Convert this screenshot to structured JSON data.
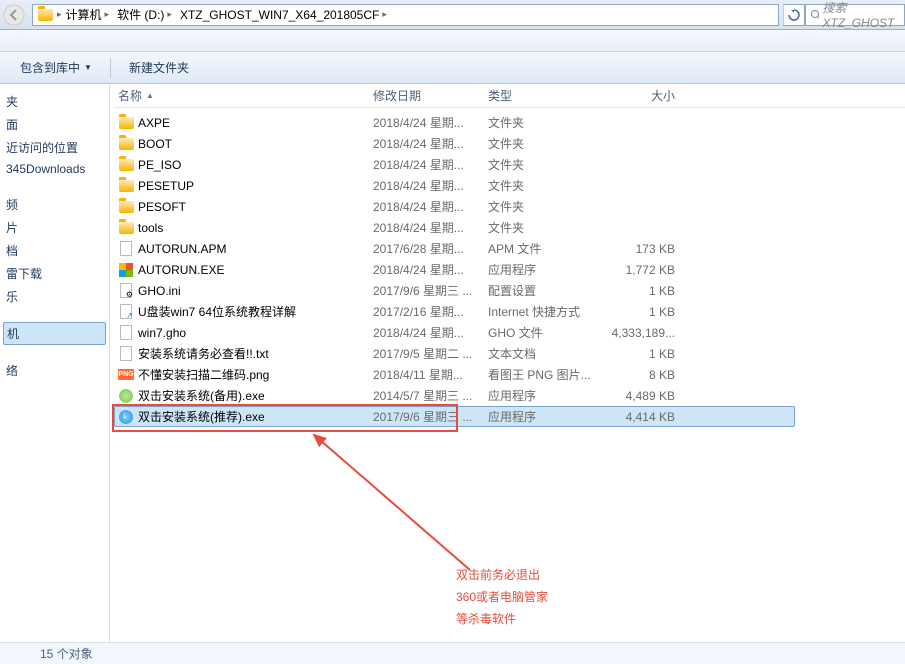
{
  "breadcrumb": {
    "root": "计算机",
    "drive": "软件 (D:)",
    "folder": "XTZ_GHOST_WIN7_X64_201805CF"
  },
  "search": {
    "placeholder": "搜索 XTZ_GHOST"
  },
  "toolbar": {
    "include": "包含到库中",
    "newfolder": "新建文件夹"
  },
  "sidebar": {
    "items": [
      "夹",
      "面",
      "近访问的位置",
      "345Downloads",
      "",
      "频",
      "片",
      "档",
      "雷下载",
      "乐",
      "",
      "机",
      "",
      "络"
    ]
  },
  "columns": {
    "name": "名称",
    "date": "修改日期",
    "type": "类型",
    "size": "大小"
  },
  "files": [
    {
      "icon": "folder",
      "name": "AXPE",
      "date": "2018/4/24 星期...",
      "type": "文件夹",
      "size": ""
    },
    {
      "icon": "folder",
      "name": "BOOT",
      "date": "2018/4/24 星期...",
      "type": "文件夹",
      "size": ""
    },
    {
      "icon": "folder",
      "name": "PE_ISO",
      "date": "2018/4/24 星期...",
      "type": "文件夹",
      "size": ""
    },
    {
      "icon": "folder",
      "name": "PESETUP",
      "date": "2018/4/24 星期...",
      "type": "文件夹",
      "size": ""
    },
    {
      "icon": "folder",
      "name": "PESOFT",
      "date": "2018/4/24 星期...",
      "type": "文件夹",
      "size": ""
    },
    {
      "icon": "folder",
      "name": "tools",
      "date": "2018/4/24 星期...",
      "type": "文件夹",
      "size": ""
    },
    {
      "icon": "file",
      "name": "AUTORUN.APM",
      "date": "2017/6/28 星期...",
      "type": "APM 文件",
      "size": "173 KB"
    },
    {
      "icon": "win",
      "name": "AUTORUN.EXE",
      "date": "2018/4/24 星期...",
      "type": "应用程序",
      "size": "1,772 KB"
    },
    {
      "icon": "ini",
      "name": "GHO.ini",
      "date": "2017/9/6 星期三 ...",
      "type": "配置设置",
      "size": "1 KB"
    },
    {
      "icon": "url",
      "name": "U盘装win7 64位系统教程详解",
      "date": "2017/2/16 星期...",
      "type": "Internet 快捷方式",
      "size": "1 KB"
    },
    {
      "icon": "file",
      "name": "win7.gho",
      "date": "2018/4/24 星期...",
      "type": "GHO 文件",
      "size": "4,333,189..."
    },
    {
      "icon": "txt",
      "name": "安装系统请务必查看!!.txt",
      "date": "2017/9/5 星期二 ...",
      "type": "文本文档",
      "size": "1 KB"
    },
    {
      "icon": "png",
      "name": "不懂安装扫描二维码.png",
      "date": "2018/4/11 星期...",
      "type": "看图王 PNG 图片...",
      "size": "8 KB"
    },
    {
      "icon": "green",
      "name": "双击安装系统(备用).exe",
      "date": "2014/5/7 星期三 ...",
      "type": "应用程序",
      "size": "4,489 KB"
    },
    {
      "icon": "blue",
      "name": "双击安装系统(推荐).exe",
      "date": "2017/9/6 星期三 ...",
      "type": "应用程序",
      "size": "4,414 KB",
      "selected": true
    }
  ],
  "annotation": {
    "line1": "双击前务必退出",
    "line2": "360或者电脑管家",
    "line3": "等杀毒软件"
  },
  "status": "15 个对象"
}
